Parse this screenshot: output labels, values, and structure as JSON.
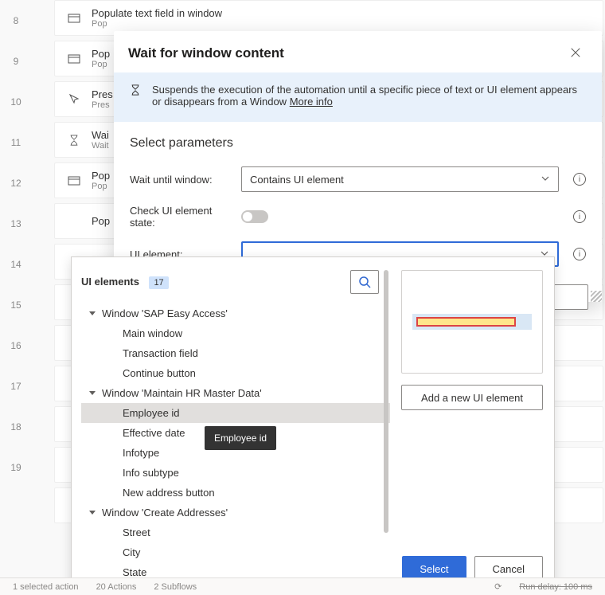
{
  "bg_rows": [
    {
      "icon": "window",
      "title": "Populate text field in window",
      "sub": "Pop"
    },
    {
      "icon": "window",
      "title": "Pop",
      "sub": "Pop"
    },
    {
      "icon": "mouse",
      "title": "Pres",
      "sub": "Pres"
    },
    {
      "icon": "hourglass",
      "title": "Wai",
      "sub": "Wait"
    },
    {
      "icon": "window",
      "title": "Pop",
      "sub": "Pop"
    },
    {
      "icon": "",
      "title": "Pop",
      "sub": ""
    },
    {
      "icon": "",
      "title": "",
      "sub": ""
    },
    {
      "icon": "",
      "title": "",
      "sub": ""
    },
    {
      "icon": "",
      "title": "",
      "sub": ""
    },
    {
      "icon": "",
      "title": "",
      "sub": ""
    },
    {
      "icon": "",
      "title": "",
      "sub": ""
    },
    {
      "icon": "",
      "title": "",
      "sub": ""
    },
    {
      "icon": "",
      "title": "",
      "sub": ""
    }
  ],
  "line_start": 8,
  "line_end": 19,
  "dialog": {
    "title": "Wait for window content",
    "banner_text": "Suspends the execution of the automation until a specific piece of text or UI element appears or disappears from a Window ",
    "more_info": "More info",
    "section": "Select parameters",
    "param_wait_label": "Wait until window:",
    "param_wait_value": "Contains UI element",
    "param_check_label": "Check UI element state:",
    "param_ui_label": "UI element:"
  },
  "picker": {
    "title": "UI elements",
    "count": "17",
    "groups": [
      {
        "name": "Window 'SAP Easy Access'",
        "items": [
          "Main window",
          "Transaction field",
          "Continue button"
        ]
      },
      {
        "name": "Window 'Maintain HR Master Data'",
        "items": [
          "Employee id",
          "Effective date",
          "Infotype",
          "Info subtype",
          "New address button"
        ]
      },
      {
        "name": "Window 'Create Addresses'",
        "items": [
          "Street",
          "City",
          "State"
        ]
      }
    ],
    "selected": "Employee id",
    "tooltip": "Employee id",
    "add_label": "Add a new UI element",
    "select_label": "Select",
    "cancel_label": "Cancel"
  },
  "status": {
    "sel": "1 selected action",
    "actions": "20 Actions",
    "subflows": "2 Subflows",
    "delay": "Run delay: 100 ms"
  }
}
